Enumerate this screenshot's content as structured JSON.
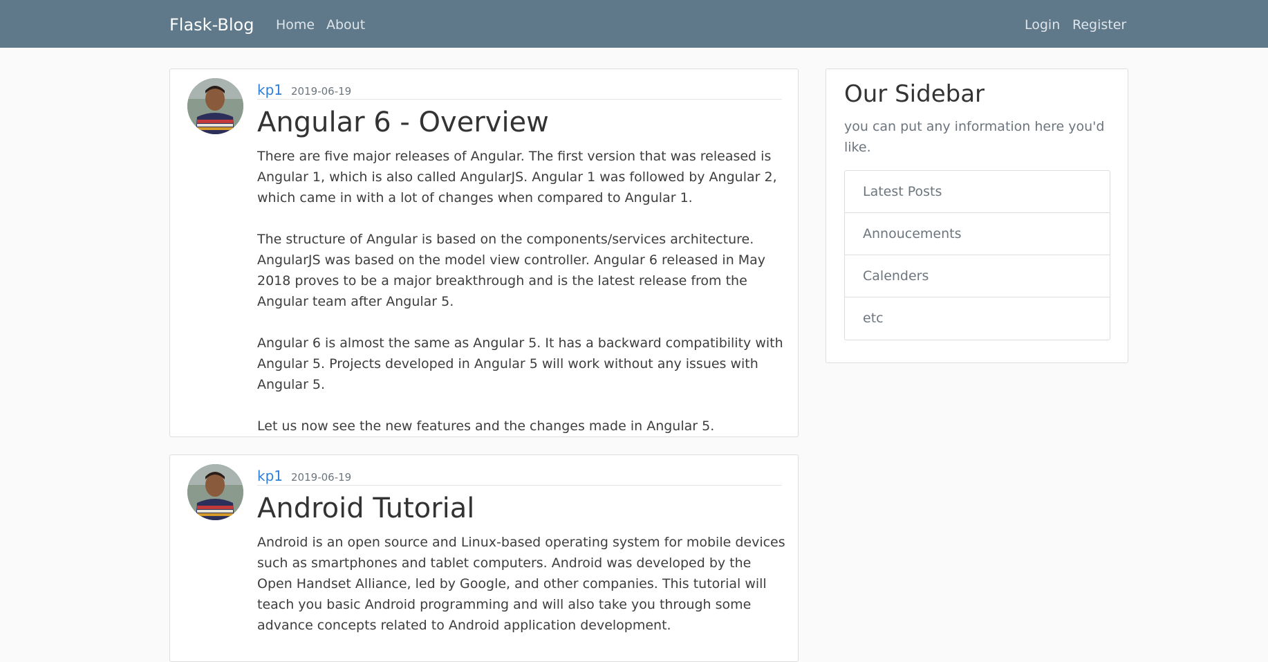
{
  "navbar": {
    "brand": "Flask-Blog",
    "left_links": [
      "Home",
      "About"
    ],
    "right_links": [
      "Login",
      "Register"
    ]
  },
  "posts": [
    {
      "author": "kp1",
      "date": "2019-06-19",
      "title": "Angular 6 - Overview",
      "paragraphs": [
        "There are five major releases of Angular. The first version that was released is Angular 1, which is also called AngularJS. Angular 1 was followed by Angular 2, which came in with a lot of changes when compared to Angular 1.",
        "The structure of Angular is based on the components/services architecture. AngularJS was based on the model view controller. Angular 6 released in May 2018 proves to be a major breakthrough and is the latest release from the Angular team after Angular 5.",
        "Angular 6 is almost the same as Angular 5. It has a backward compatibility with Angular 5. Projects developed in Angular 5 will work without any issues with Angular 5.",
        "Let us now see the new features and the changes made in Angular 5."
      ]
    },
    {
      "author": "kp1",
      "date": "2019-06-19",
      "title": "Android Tutorial",
      "paragraphs": [
        "Android is an open source and Linux-based operating system for mobile devices such as smartphones and tablet computers. Android was developed by the Open Handset Alliance, led by Google, and other companies. This tutorial will teach you basic Android programming and will also take you through some advance concepts related to Android application development."
      ]
    }
  ],
  "sidebar": {
    "title": "Our Sidebar",
    "lead": "you can put any information here you'd like.",
    "items": [
      "Latest Posts",
      "Annoucements",
      "Calenders",
      "etc"
    ]
  },
  "colors": {
    "navbar_bg": "#5f788a",
    "link_blue": "#2f7fd8",
    "page_bg": "#fafafa"
  }
}
